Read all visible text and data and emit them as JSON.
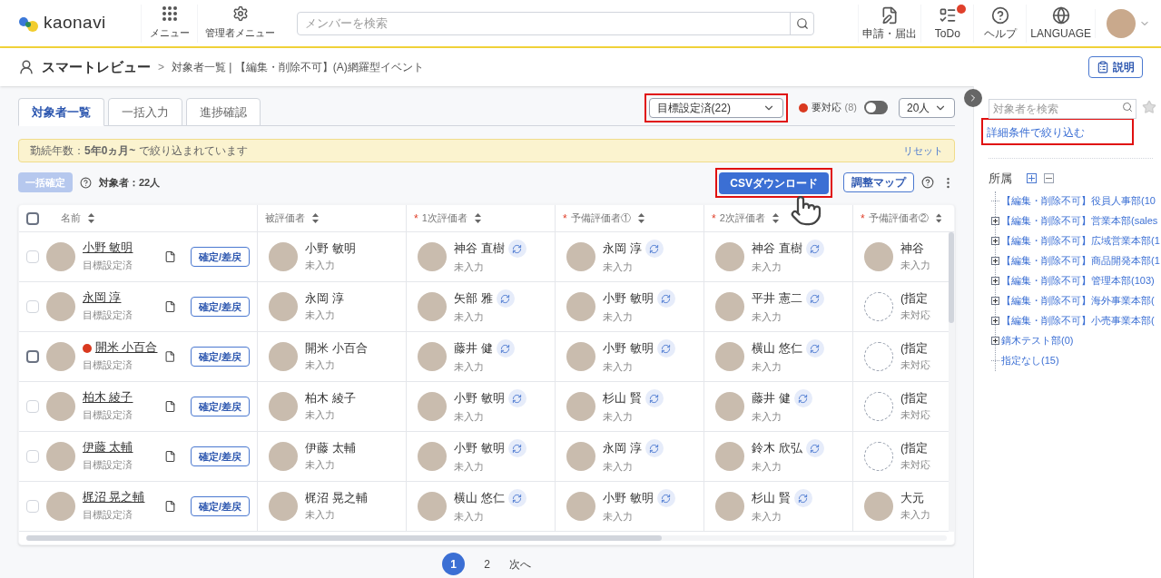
{
  "header": {
    "logo": "kaonavi",
    "search_placeholder": "メンバーを検索",
    "left_nav": [
      {
        "label": "メニュー"
      },
      {
        "label": "管理者メニュー"
      }
    ],
    "right_nav": [
      {
        "label": "申請・届出",
        "badge": false
      },
      {
        "label": "ToDo",
        "badge": true
      },
      {
        "label": "ヘルプ",
        "badge": false
      },
      {
        "label": "LANGUAGE",
        "badge": false
      }
    ]
  },
  "breadcrumb": {
    "title": "スマートレビュー",
    "separator": ">",
    "path": "対象者一覧 | 【編集・削除不可】(A)網羅型イベント",
    "help_button": "説明"
  },
  "tabs": [
    {
      "label": "対象者一覧",
      "selected": true
    },
    {
      "label": "一括入力",
      "selected": false
    },
    {
      "label": "進捗確認",
      "selected": false
    }
  ],
  "status_filter": {
    "value": "目標設定済(22)"
  },
  "needs_action": {
    "label": "要対応",
    "count": "(8)",
    "on": false
  },
  "page_size": {
    "value": "20人"
  },
  "filter_banner": {
    "text": "勤続年数：**5年0ヵ月~** で絞り込まれています",
    "reset": "リセット"
  },
  "toolbar": {
    "bulk_confirm": "一括確定",
    "bulk_disabled": true,
    "count": "対象者：22人",
    "csv": "CSVダウンロード",
    "map": "調整マップ"
  },
  "select_all_checked": false,
  "required_mark": "*",
  "columns": [
    {
      "label": "名前",
      "required": false
    },
    {
      "label": "被評価者",
      "required": false
    },
    {
      "label": "1次評価者",
      "required": true
    },
    {
      "label": "予備評価者①",
      "required": true
    },
    {
      "label": "2次評価者",
      "required": true
    },
    {
      "label": "予備評価者②",
      "required": true
    }
  ],
  "rows": [
    {
      "name": "小野 敏明",
      "status": "目標設定済",
      "alert": false,
      "checked": false,
      "disabled": true,
      "action": "確定/差戻",
      "evaluee": {
        "name": "小野 敏明",
        "status": "未入力"
      },
      "evaluators": [
        {
          "kind": "person",
          "name": "神谷 直樹",
          "status": "未入力",
          "swap": true
        },
        {
          "kind": "person",
          "name": "永岡 淳",
          "status": "未入力",
          "swap": true
        },
        {
          "kind": "person",
          "name": "神谷 直樹",
          "status": "未入力",
          "swap": true
        },
        {
          "kind": "person",
          "name": "神谷",
          "status": "未入力",
          "swap": false
        }
      ]
    },
    {
      "name": "永岡 淳",
      "status": "目標設定済",
      "alert": false,
      "checked": false,
      "disabled": true,
      "action": "確定/差戻",
      "evaluee": {
        "name": "永岡 淳",
        "status": "未入力"
      },
      "evaluators": [
        {
          "kind": "person",
          "name": "矢部 雅",
          "status": "未入力",
          "swap": true
        },
        {
          "kind": "person",
          "name": "小野 敏明",
          "status": "未入力",
          "swap": true
        },
        {
          "kind": "person",
          "name": "平井 憲二",
          "status": "未入力",
          "swap": true
        },
        {
          "kind": "unassigned",
          "name": "(指定",
          "status": "未対応",
          "swap": false
        }
      ]
    },
    {
      "name": "開米 小百合",
      "status": "目標設定済",
      "alert": true,
      "checked": false,
      "disabled": false,
      "action": "確定/差戻",
      "evaluee": {
        "name": "開米 小百合",
        "status": "未入力"
      },
      "evaluators": [
        {
          "kind": "person",
          "name": "藤井 健",
          "status": "未入力",
          "swap": true
        },
        {
          "kind": "person",
          "name": "小野 敏明",
          "status": "未入力",
          "swap": true
        },
        {
          "kind": "person",
          "name": "横山 悠仁",
          "status": "未入力",
          "swap": true
        },
        {
          "kind": "unassigned",
          "name": "(指定",
          "status": "未対応",
          "swap": false
        }
      ]
    },
    {
      "name": "柏木 綾子",
      "status": "目標設定済",
      "alert": false,
      "checked": false,
      "disabled": true,
      "action": "確定/差戻",
      "evaluee": {
        "name": "柏木 綾子",
        "status": "未入力"
      },
      "evaluators": [
        {
          "kind": "person",
          "name": "小野 敏明",
          "status": "未入力",
          "swap": true
        },
        {
          "kind": "person",
          "name": "杉山 賢",
          "status": "未入力",
          "swap": true
        },
        {
          "kind": "person",
          "name": "藤井 健",
          "status": "未入力",
          "swap": true
        },
        {
          "kind": "unassigned",
          "name": "(指定",
          "status": "未対応",
          "swap": false
        }
      ]
    },
    {
      "name": "伊藤 太輔",
      "status": "目標設定済",
      "alert": false,
      "checked": false,
      "disabled": true,
      "action": "確定/差戻",
      "evaluee": {
        "name": "伊藤 太輔",
        "status": "未入力"
      },
      "evaluators": [
        {
          "kind": "person",
          "name": "小野 敏明",
          "status": "未入力",
          "swap": true
        },
        {
          "kind": "person",
          "name": "永岡 淳",
          "status": "未入力",
          "swap": true
        },
        {
          "kind": "person",
          "name": "鈴木 欣弘",
          "status": "未入力",
          "swap": true
        },
        {
          "kind": "unassigned",
          "name": "(指定",
          "status": "未対応",
          "swap": false
        }
      ]
    },
    {
      "name": "梶沼 晃之輔",
      "status": "目標設定済",
      "alert": false,
      "checked": false,
      "disabled": true,
      "action": "確定/差戻",
      "evaluee": {
        "name": "梶沼 晃之輔",
        "status": "未入力"
      },
      "evaluators": [
        {
          "kind": "person",
          "name": "横山 悠仁",
          "status": "未入力",
          "swap": true
        },
        {
          "kind": "person",
          "name": "小野 敏明",
          "status": "未入力",
          "swap": true
        },
        {
          "kind": "person",
          "name": "杉山 賢",
          "status": "未入力",
          "swap": true
        },
        {
          "kind": "person",
          "name": "大元",
          "status": "未入力",
          "swap": false
        }
      ]
    }
  ],
  "pagination": {
    "pages": [
      {
        "label": "1",
        "selected": true
      },
      {
        "label": "2",
        "selected": false
      }
    ],
    "next": "次へ"
  },
  "sidebar": {
    "search_placeholder": "対象者を検索",
    "advanced_filter": "詳細条件で絞り込む",
    "section": "所属",
    "tree": [
      {
        "label": "【編集・削除不可】役員人事部(10",
        "expandable": false
      },
      {
        "label": "【編集・削除不可】営業本部(sales",
        "expandable": true
      },
      {
        "label": "【編集・削除不可】広域営業本部(1",
        "expandable": true
      },
      {
        "label": "【編集・削除不可】商品開発本部(1",
        "expandable": true
      },
      {
        "label": "【編集・削除不可】管理本部(103)",
        "expandable": true
      },
      {
        "label": "【編集・削除不可】海外事業本部(",
        "expandable": true
      },
      {
        "label": "【編集・削除不可】小売事業本部(",
        "expandable": true
      },
      {
        "label": "鏑木テスト部(0)",
        "expandable": true
      },
      {
        "label": "指定なし(15)",
        "expandable": false
      }
    ]
  }
}
